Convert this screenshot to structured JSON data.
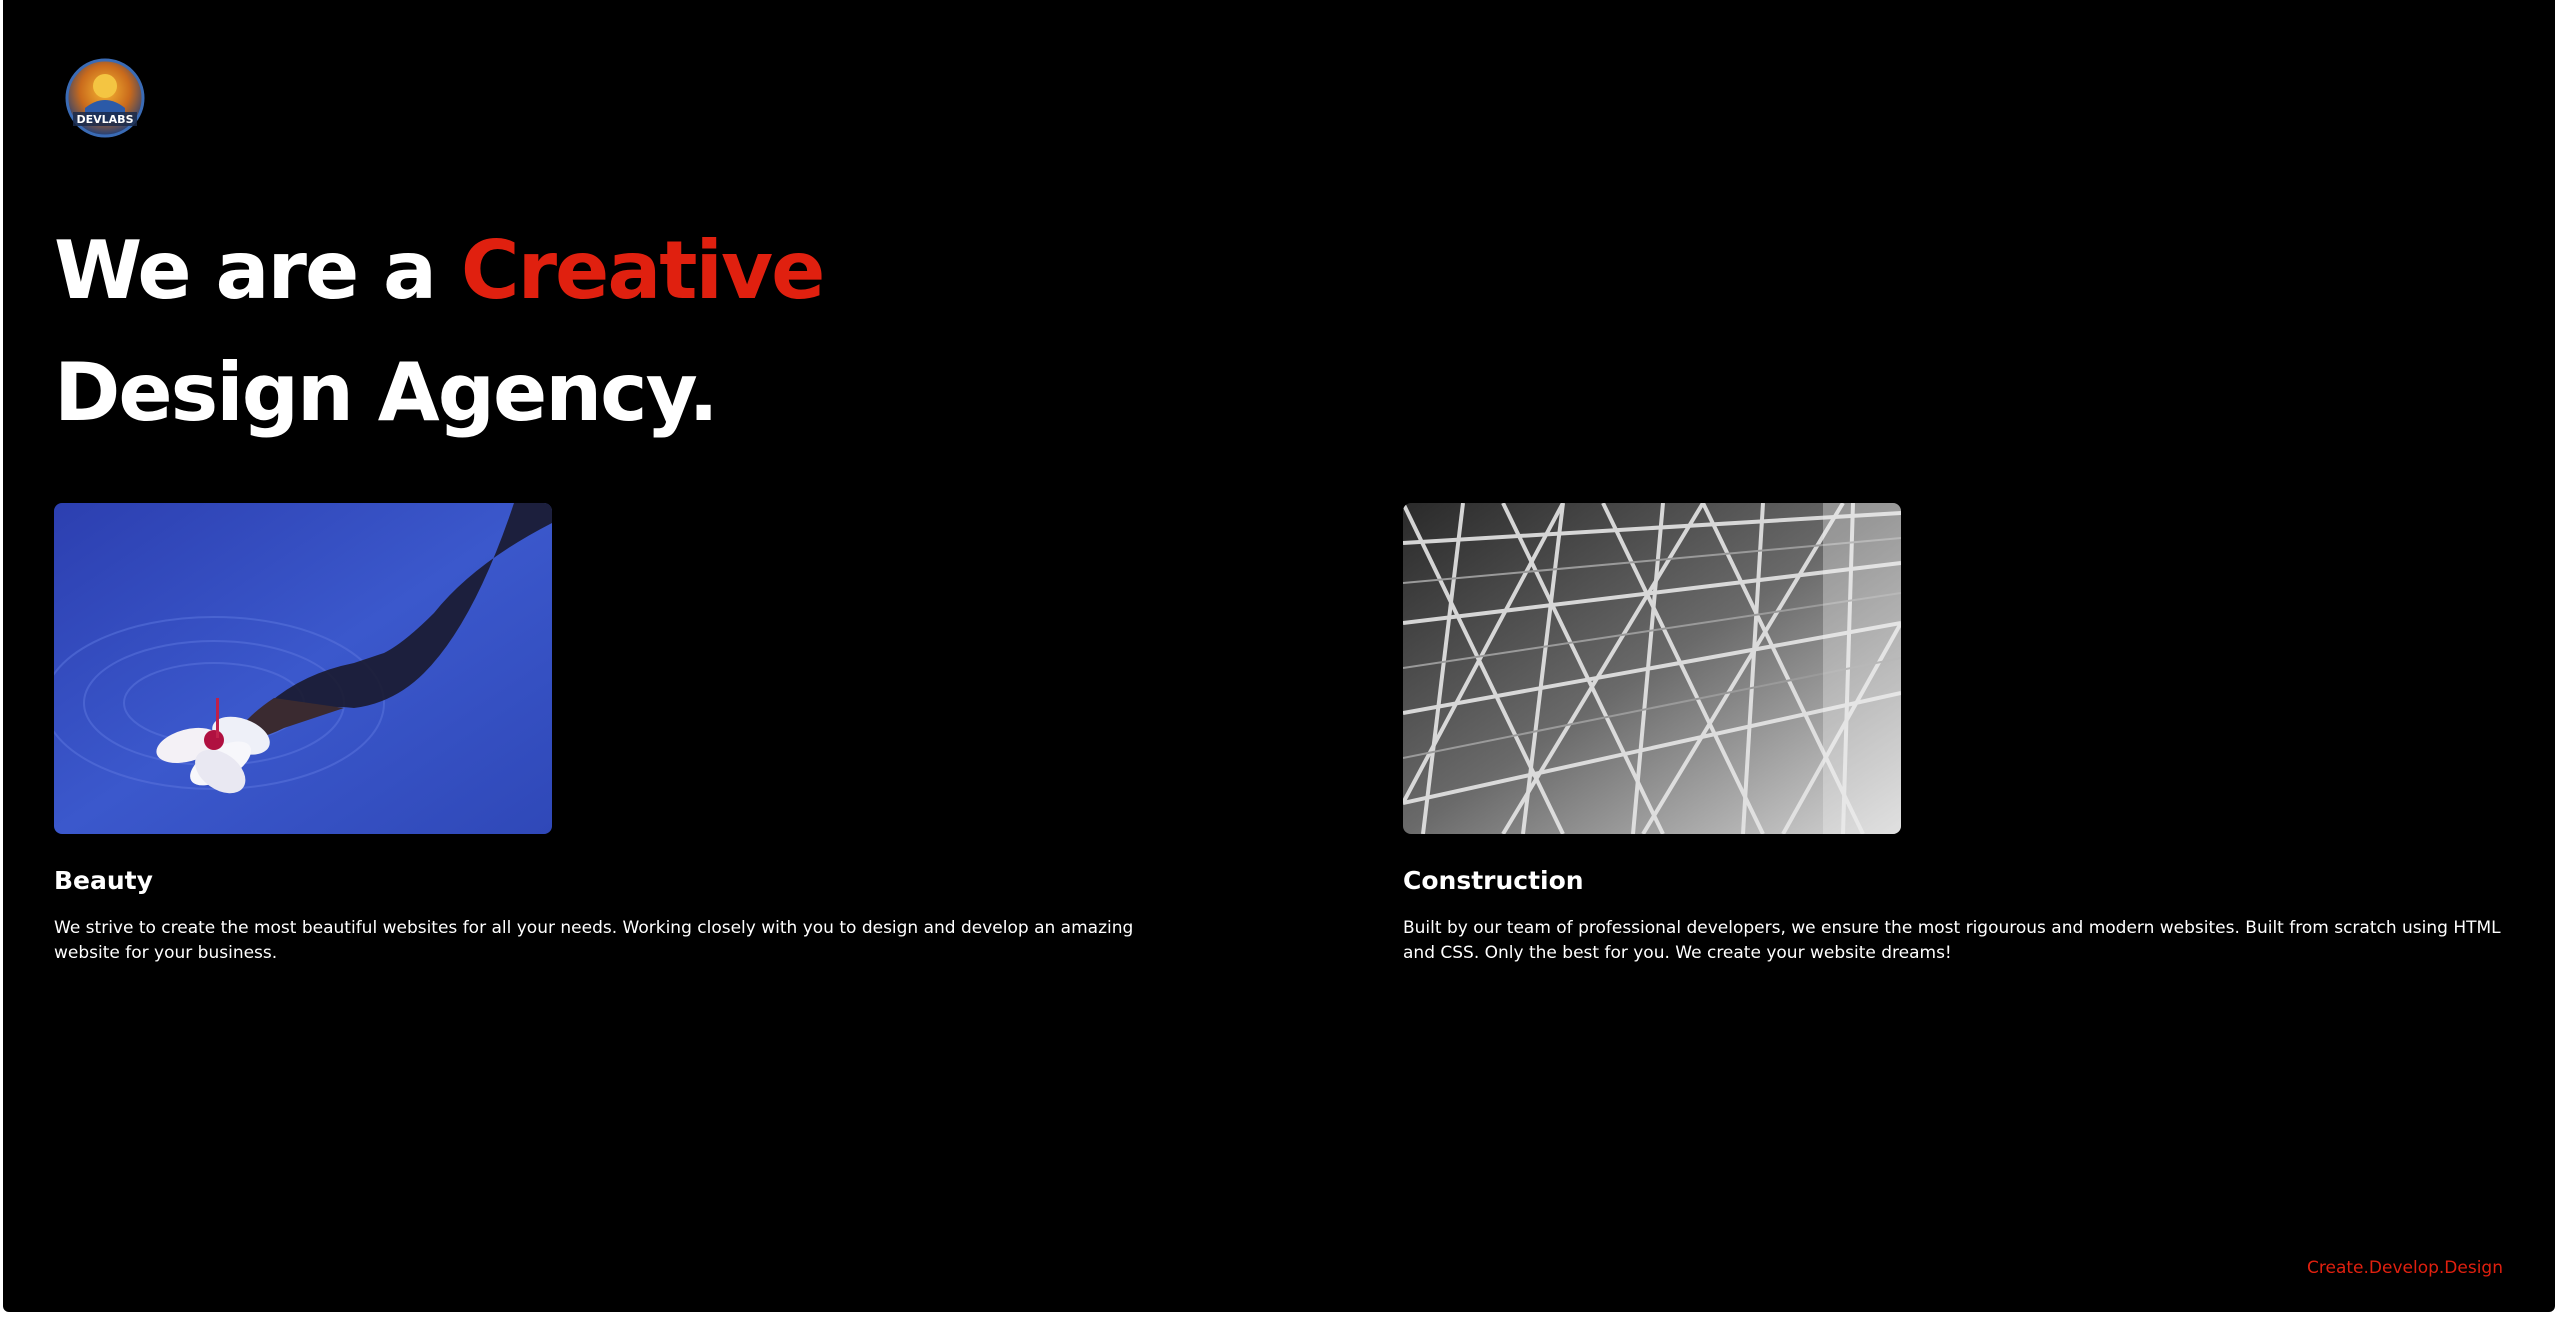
{
  "brand": {
    "logo_text": "DEVLABS"
  },
  "hero": {
    "line1_prefix": "We are a ",
    "line1_accent": "Creative",
    "line2": "Design Agency."
  },
  "cards": [
    {
      "title": "Beauty",
      "image": "hand-touching-water-with-hibiscus-flower",
      "text": "We strive to create the most beautiful websites for all your needs. Working closely with you to design and develop an amazing website for your business."
    },
    {
      "title": "Construction",
      "image": "steel-scaffolding-structure-black-and-white",
      "text": "Built by our team of professional developers, we ensure the most rigourous and modern websites. Built from scratch using HTML and CSS. Only the best for you. We create your website dreams!"
    }
  ],
  "footer": {
    "tagline": "Create.Develop.Design"
  },
  "colors": {
    "background": "#000000",
    "text": "#ffffff",
    "accent": "#e0200f"
  }
}
